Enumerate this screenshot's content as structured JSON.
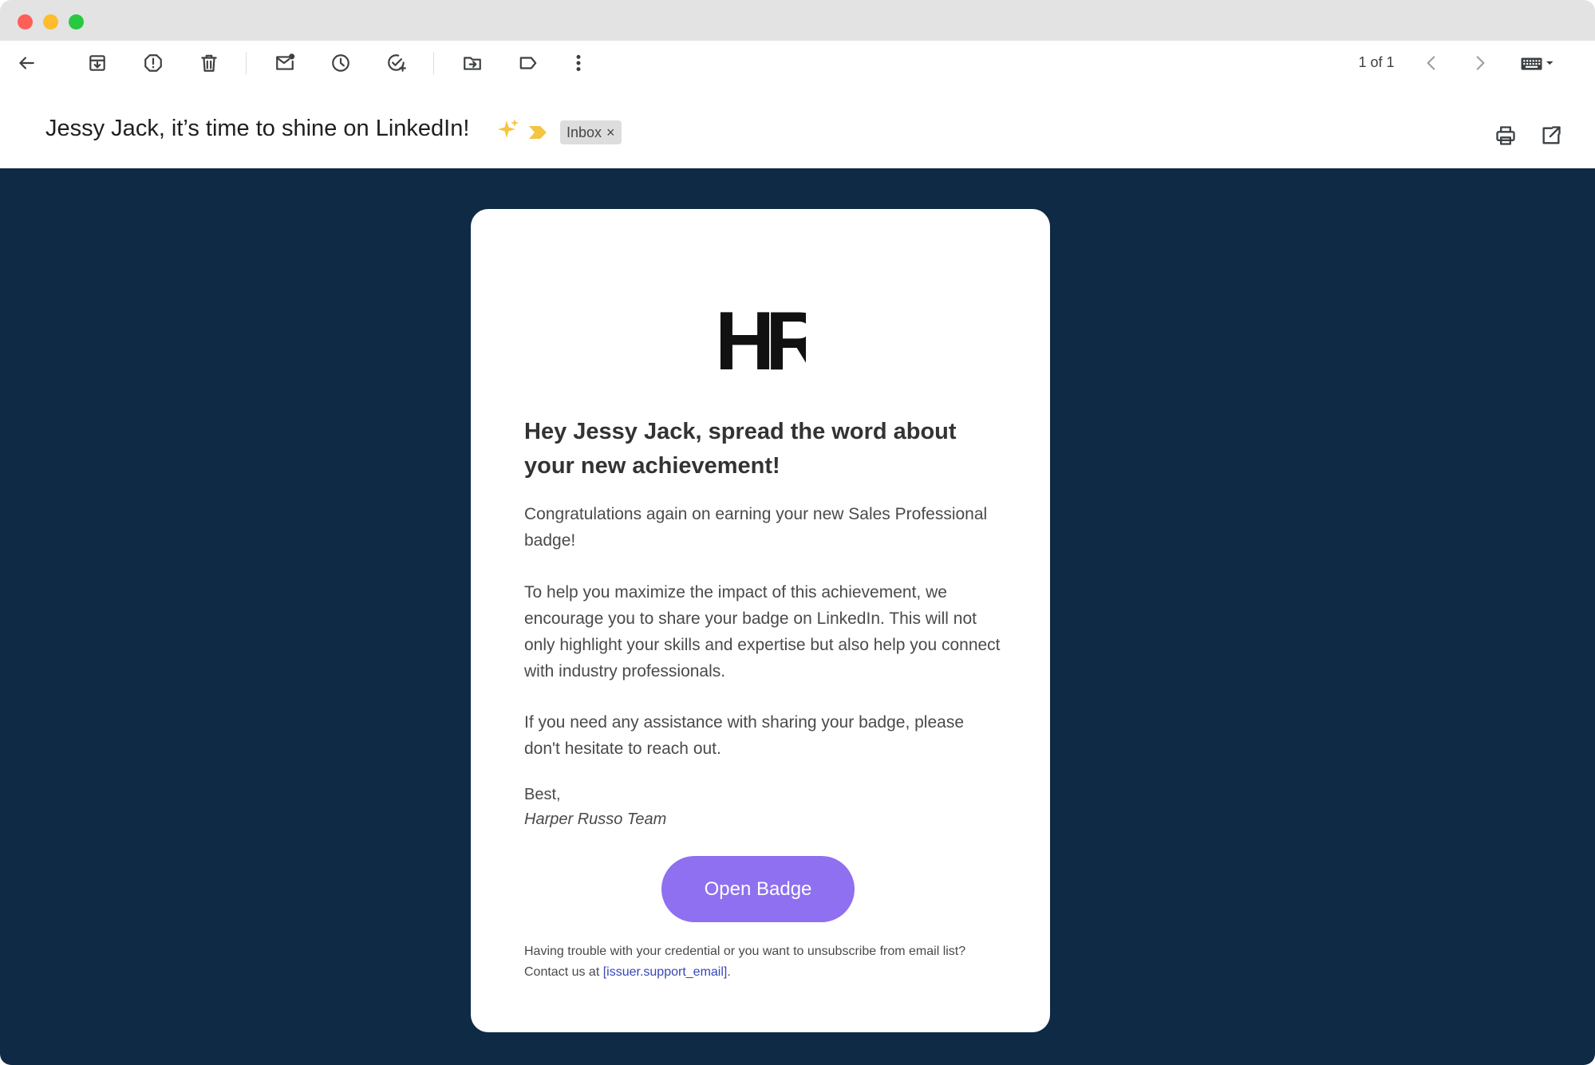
{
  "toolbar": {
    "pager_text": "1 of 1",
    "icons": [
      "back-arrow-icon",
      "archive-icon",
      "report-spam-icon",
      "delete-icon",
      "mark-unread-icon",
      "snooze-icon",
      "add-task-icon",
      "move-to-icon",
      "label-icon",
      "more-vert-icon",
      "chevron-left-icon",
      "chevron-right-icon",
      "keyboard-icon"
    ]
  },
  "subject": {
    "title": "Jessy Jack, it’s time to shine on LinkedIn!",
    "label_chip": "Inbox",
    "chip_close": "×",
    "sparkle_color": "#f4c542",
    "importance_color": "#f4c542"
  },
  "email": {
    "background_color": "#0e2a45",
    "logo_text": "HR.",
    "heading": "Hey Jessy Jack, spread the word about your new achievement!",
    "paragraph_1": "Congratulations again on earning your new Sales Professional badge!",
    "paragraph_2": "To help you maximize the impact of this achievement, we encourage you to share your badge on LinkedIn. This will not only highlight your skills and expertise but also help you connect with industry professionals.",
    "paragraph_3": "If you need any assistance with sharing your badge, please don't hesitate to reach out.",
    "signoff": "Best,",
    "team_name": "Harper Russo Team",
    "cta_label": "Open Badge",
    "cta_color": "#8e70f0",
    "footer_text": "Having trouble with your credential or you want to unsubscribe from email list? Contact us at ",
    "footer_link": "[issuer.support_email]",
    "footer_end": "."
  }
}
